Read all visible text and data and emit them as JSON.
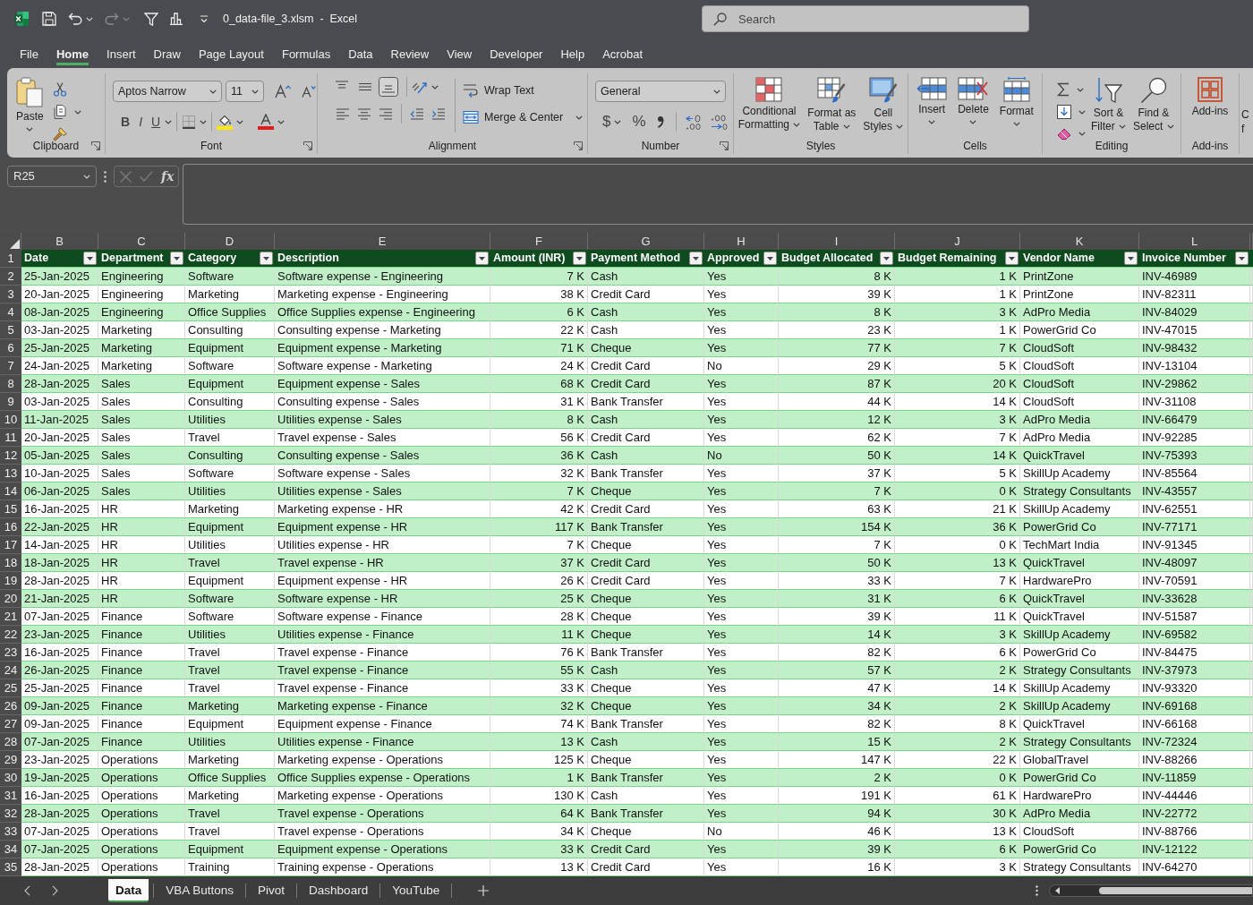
{
  "title_bar": {
    "title": "0_data-file_3.xlsm  -  Excel",
    "redo": {
      "disabled": true
    },
    "search": {
      "placeholder": "Search"
    }
  },
  "menu_tabs": [
    {
      "label": "File",
      "selected": false
    },
    {
      "label": "Home",
      "selected": true
    },
    {
      "label": "Insert",
      "selected": false
    },
    {
      "label": "Draw",
      "selected": false
    },
    {
      "label": "Page Layout",
      "selected": false
    },
    {
      "label": "Formulas",
      "selected": false
    },
    {
      "label": "Data",
      "selected": false
    },
    {
      "label": "Review",
      "selected": false
    },
    {
      "label": "View",
      "selected": false
    },
    {
      "label": "Developer",
      "selected": false
    },
    {
      "label": "Help",
      "selected": false
    },
    {
      "label": "Acrobat",
      "selected": false
    }
  ],
  "ribbon": {
    "clipboard": {
      "label": "Clipboard",
      "paste": "Paste"
    },
    "font": {
      "label": "Font",
      "font_name": "Aptos Narrow",
      "font_size": "11",
      "bold": "B",
      "italic": "I",
      "underline": "U"
    },
    "alignment": {
      "label": "Alignment",
      "vertical_align": [
        {
          "selected": false
        },
        {
          "selected": false
        },
        {
          "selected": true
        }
      ],
      "wrap_text": "Wrap Text",
      "merge_center": "Merge & Center"
    },
    "number": {
      "label": "Number",
      "format": "General",
      "currency": "$",
      "percent": "%"
    },
    "styles": {
      "label": "Styles",
      "buttons": [
        "Conditional\nFormatting",
        "Format as\nTable",
        "Cell\nStyles"
      ]
    },
    "cells": {
      "label": "Cells",
      "buttons": [
        "Insert",
        "Delete",
        "Format"
      ]
    },
    "editing": {
      "label": "Editing",
      "buttons": [
        "Sort &\nFilter",
        "Find &\nSelect"
      ]
    },
    "add_ins": {
      "label": "Add-ins",
      "button": "Add-ins"
    },
    "cut_off_button": {
      "label": "C\nf"
    }
  },
  "formula_bar": {
    "name_box": "R25",
    "edit_buttons": {
      "disabled": true
    },
    "function_label": "fx"
  },
  "table": {
    "header_row_number": "1",
    "columns": [
      {
        "letter": "B",
        "header": "Date",
        "kind": "text"
      },
      {
        "letter": "C",
        "header": "Department",
        "kind": "text"
      },
      {
        "letter": "D",
        "header": "Category",
        "kind": "text"
      },
      {
        "letter": "E",
        "header": "Description",
        "kind": "text"
      },
      {
        "letter": "F",
        "header": "Amount (INR)",
        "kind": "number"
      },
      {
        "letter": "G",
        "header": "Payment Method",
        "kind": "text"
      },
      {
        "letter": "H",
        "header": "Approved",
        "kind": "text"
      },
      {
        "letter": "I",
        "header": "Budget Allocated",
        "kind": "number"
      },
      {
        "letter": "J",
        "header": "Budget Remaining",
        "kind": "number"
      },
      {
        "letter": "K",
        "header": "Vendor Name",
        "kind": "text"
      },
      {
        "letter": "L",
        "header": "Invoice Number",
        "kind": "text"
      }
    ],
    "rows": [
      {
        "number": "2",
        "cells": [
          "25-Jan-2025",
          "Engineering",
          "Software",
          "Software expense - Engineering",
          "7 K",
          "Cash",
          "Yes",
          "8 K",
          "1 K",
          "PrintZone",
          "INV-46989"
        ]
      },
      {
        "number": "3",
        "cells": [
          "20-Jan-2025",
          "Engineering",
          "Marketing",
          "Marketing expense - Engineering",
          "38 K",
          "Credit Card",
          "Yes",
          "39 K",
          "1 K",
          "PrintZone",
          "INV-82311"
        ]
      },
      {
        "number": "4",
        "cells": [
          "08-Jan-2025",
          "Engineering",
          "Office Supplies",
          "Office Supplies expense - Engineering",
          "6 K",
          "Cash",
          "Yes",
          "8 K",
          "3 K",
          "AdPro Media",
          "INV-84029"
        ]
      },
      {
        "number": "5",
        "cells": [
          "03-Jan-2025",
          "Marketing",
          "Consulting",
          "Consulting expense - Marketing",
          "22 K",
          "Cash",
          "Yes",
          "23 K",
          "1 K",
          "PowerGrid Co",
          "INV-47015"
        ]
      },
      {
        "number": "6",
        "cells": [
          "25-Jan-2025",
          "Marketing",
          "Equipment",
          "Equipment expense - Marketing",
          "71 K",
          "Cheque",
          "Yes",
          "77 K",
          "7 K",
          "CloudSoft",
          "INV-98432"
        ]
      },
      {
        "number": "7",
        "cells": [
          "24-Jan-2025",
          "Marketing",
          "Software",
          "Software expense - Marketing",
          "24 K",
          "Credit Card",
          "No",
          "29 K",
          "5 K",
          "CloudSoft",
          "INV-13104"
        ]
      },
      {
        "number": "8",
        "cells": [
          "28-Jan-2025",
          "Sales",
          "Equipment",
          "Equipment expense - Sales",
          "68 K",
          "Credit Card",
          "Yes",
          "87 K",
          "20 K",
          "CloudSoft",
          "INV-29862"
        ]
      },
      {
        "number": "9",
        "cells": [
          "03-Jan-2025",
          "Sales",
          "Consulting",
          "Consulting expense - Sales",
          "31 K",
          "Bank Transfer",
          "Yes",
          "44 K",
          "14 K",
          "CloudSoft",
          "INV-31108"
        ]
      },
      {
        "number": "10",
        "cells": [
          "11-Jan-2025",
          "Sales",
          "Utilities",
          "Utilities expense - Sales",
          "8 K",
          "Cash",
          "Yes",
          "12 K",
          "3 K",
          "AdPro Media",
          "INV-66479"
        ]
      },
      {
        "number": "11",
        "cells": [
          "20-Jan-2025",
          "Sales",
          "Travel",
          "Travel expense - Sales",
          "56 K",
          "Credit Card",
          "Yes",
          "62 K",
          "7 K",
          "AdPro Media",
          "INV-92285"
        ]
      },
      {
        "number": "12",
        "cells": [
          "05-Jan-2025",
          "Sales",
          "Consulting",
          "Consulting expense - Sales",
          "36 K",
          "Cash",
          "No",
          "50 K",
          "14 K",
          "QuickTravel",
          "INV-75393"
        ]
      },
      {
        "number": "13",
        "cells": [
          "10-Jan-2025",
          "Sales",
          "Software",
          "Software expense - Sales",
          "32 K",
          "Bank Transfer",
          "Yes",
          "37 K",
          "5 K",
          "SkillUp Academy",
          "INV-85564"
        ]
      },
      {
        "number": "14",
        "cells": [
          "06-Jan-2025",
          "Sales",
          "Utilities",
          "Utilities expense - Sales",
          "7 K",
          "Cheque",
          "Yes",
          "7 K",
          "0 K",
          "Strategy Consultants",
          "INV-43557"
        ]
      },
      {
        "number": "15",
        "cells": [
          "16-Jan-2025",
          "HR",
          "Marketing",
          "Marketing expense - HR",
          "42 K",
          "Credit Card",
          "Yes",
          "63 K",
          "21 K",
          "SkillUp Academy",
          "INV-62551"
        ]
      },
      {
        "number": "16",
        "cells": [
          "22-Jan-2025",
          "HR",
          "Equipment",
          "Equipment expense - HR",
          "117 K",
          "Bank Transfer",
          "Yes",
          "154 K",
          "36 K",
          "PowerGrid Co",
          "INV-77171"
        ]
      },
      {
        "number": "17",
        "cells": [
          "14-Jan-2025",
          "HR",
          "Utilities",
          "Utilities expense - HR",
          "7 K",
          "Cheque",
          "Yes",
          "7 K",
          "0 K",
          "TechMart India",
          "INV-91345"
        ]
      },
      {
        "number": "18",
        "cells": [
          "18-Jan-2025",
          "HR",
          "Travel",
          "Travel expense - HR",
          "37 K",
          "Credit Card",
          "Yes",
          "50 K",
          "13 K",
          "QuickTravel",
          "INV-48097"
        ]
      },
      {
        "number": "19",
        "cells": [
          "28-Jan-2025",
          "HR",
          "Equipment",
          "Equipment expense - HR",
          "26 K",
          "Credit Card",
          "Yes",
          "33 K",
          "7 K",
          "HardwarePro",
          "INV-70591"
        ]
      },
      {
        "number": "20",
        "cells": [
          "21-Jan-2025",
          "HR",
          "Software",
          "Software expense - HR",
          "25 K",
          "Cheque",
          "Yes",
          "31 K",
          "6 K",
          "QuickTravel",
          "INV-33628"
        ]
      },
      {
        "number": "21",
        "cells": [
          "07-Jan-2025",
          "Finance",
          "Software",
          "Software expense - Finance",
          "28 K",
          "Cheque",
          "Yes",
          "39 K",
          "11 K",
          "QuickTravel",
          "INV-51587"
        ]
      },
      {
        "number": "22",
        "cells": [
          "23-Jan-2025",
          "Finance",
          "Utilities",
          "Utilities expense - Finance",
          "11 K",
          "Cheque",
          "Yes",
          "14 K",
          "3 K",
          "SkillUp Academy",
          "INV-69582"
        ]
      },
      {
        "number": "23",
        "cells": [
          "16-Jan-2025",
          "Finance",
          "Travel",
          "Travel expense - Finance",
          "76 K",
          "Bank Transfer",
          "Yes",
          "82 K",
          "6 K",
          "PowerGrid Co",
          "INV-84475"
        ]
      },
      {
        "number": "24",
        "cells": [
          "26-Jan-2025",
          "Finance",
          "Travel",
          "Travel expense - Finance",
          "55 K",
          "Cash",
          "Yes",
          "57 K",
          "2 K",
          "Strategy Consultants",
          "INV-37973"
        ]
      },
      {
        "number": "25",
        "cells": [
          "25-Jan-2025",
          "Finance",
          "Travel",
          "Travel expense - Finance",
          "33 K",
          "Cheque",
          "Yes",
          "47 K",
          "14 K",
          "SkillUp Academy",
          "INV-93320"
        ]
      },
      {
        "number": "26",
        "cells": [
          "09-Jan-2025",
          "Finance",
          "Marketing",
          "Marketing expense - Finance",
          "32 K",
          "Cheque",
          "Yes",
          "34 K",
          "2 K",
          "SkillUp Academy",
          "INV-69168"
        ]
      },
      {
        "number": "27",
        "cells": [
          "09-Jan-2025",
          "Finance",
          "Equipment",
          "Equipment expense - Finance",
          "74 K",
          "Bank Transfer",
          "Yes",
          "82 K",
          "8 K",
          "QuickTravel",
          "INV-66168"
        ]
      },
      {
        "number": "28",
        "cells": [
          "07-Jan-2025",
          "Finance",
          "Utilities",
          "Utilities expense - Finance",
          "13 K",
          "Cash",
          "Yes",
          "15 K",
          "2 K",
          "Strategy Consultants",
          "INV-72324"
        ]
      },
      {
        "number": "29",
        "cells": [
          "23-Jan-2025",
          "Operations",
          "Marketing",
          "Marketing expense - Operations",
          "125 K",
          "Cheque",
          "Yes",
          "147 K",
          "22 K",
          "GlobalTravel",
          "INV-88266"
        ]
      },
      {
        "number": "30",
        "cells": [
          "19-Jan-2025",
          "Operations",
          "Office Supplies",
          "Office Supplies expense - Operations",
          "1 K",
          "Bank Transfer",
          "Yes",
          "2 K",
          "0 K",
          "PowerGrid Co",
          "INV-11859"
        ]
      },
      {
        "number": "31",
        "cells": [
          "16-Jan-2025",
          "Operations",
          "Marketing",
          "Marketing expense - Operations",
          "130 K",
          "Cash",
          "Yes",
          "191 K",
          "61 K",
          "HardwarePro",
          "INV-44446"
        ]
      },
      {
        "number": "32",
        "cells": [
          "28-Jan-2025",
          "Operations",
          "Travel",
          "Travel expense - Operations",
          "64 K",
          "Bank Transfer",
          "Yes",
          "94 K",
          "30 K",
          "AdPro Media",
          "INV-22772"
        ]
      },
      {
        "number": "33",
        "cells": [
          "07-Jan-2025",
          "Operations",
          "Travel",
          "Travel expense - Operations",
          "34 K",
          "Cheque",
          "No",
          "46 K",
          "13 K",
          "CloudSoft",
          "INV-88766"
        ]
      },
      {
        "number": "34",
        "cells": [
          "07-Jan-2025",
          "Operations",
          "Equipment",
          "Equipment expense - Operations",
          "33 K",
          "Credit Card",
          "Yes",
          "39 K",
          "6 K",
          "PowerGrid Co",
          "INV-12122"
        ]
      },
      {
        "number": "35",
        "cells": [
          "28-Jan-2025",
          "Operations",
          "Training",
          "Training expense - Operations",
          "13 K",
          "Credit Card",
          "Yes",
          "16 K",
          "3 K",
          "Strategy Consultants",
          "INV-64270"
        ]
      }
    ]
  },
  "sheet_tabs": [
    {
      "label": "Data",
      "selected": true
    },
    {
      "label": "VBA Buttons",
      "selected": false
    },
    {
      "label": "Pivot",
      "selected": false
    },
    {
      "label": "Dashboard",
      "selected": false
    },
    {
      "label": "YouTube",
      "selected": false
    }
  ]
}
